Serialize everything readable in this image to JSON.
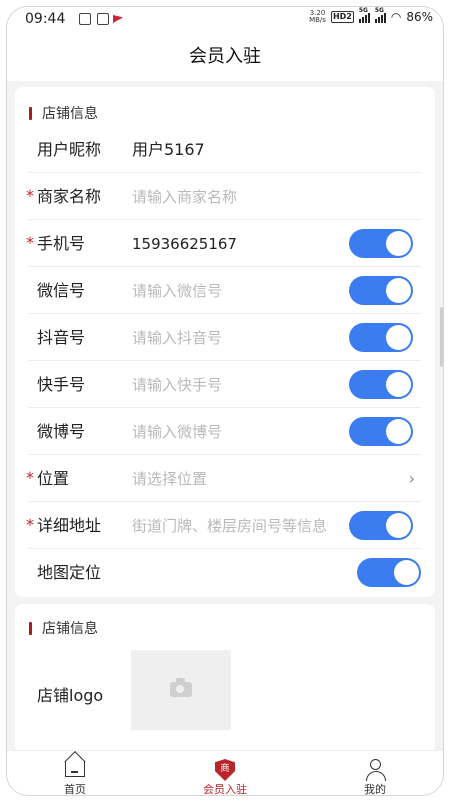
{
  "status_bar": {
    "time": "09:44",
    "net_speed_top": "3.20",
    "net_speed_unit": "MB/s",
    "hd": "HD2",
    "sig1": "5G",
    "sig2": "5G",
    "battery": "86%"
  },
  "header": {
    "title": "会员入驻"
  },
  "store_info": {
    "title": "店铺信息",
    "fields": [
      {
        "label": "用户昵称",
        "value": "用户5167",
        "required": false
      },
      {
        "label": "商家名称",
        "placeholder": "请输入商家名称",
        "required": true
      },
      {
        "label": "手机号",
        "value": "15936625167",
        "required": true,
        "toggle": true
      },
      {
        "label": "微信号",
        "placeholder": "请输入微信号",
        "required": false,
        "toggle": true
      },
      {
        "label": "抖音号",
        "placeholder": "请输入抖音号",
        "required": false,
        "toggle": true
      },
      {
        "label": "快手号",
        "placeholder": "请输入快手号",
        "required": false,
        "toggle": true
      },
      {
        "label": "微博号",
        "placeholder": "请输入微博号",
        "required": false,
        "toggle": true
      },
      {
        "label": "位置",
        "placeholder": "请选择位置",
        "required": true,
        "chevron": "›"
      },
      {
        "label": "详细地址",
        "placeholder": "街道门牌、楼层房间号等信息",
        "required": true,
        "toggle": true
      },
      {
        "label": "地图定位",
        "required": false,
        "toggle": true
      }
    ],
    "required_mark": "*"
  },
  "store_info_2": {
    "title": "店铺信息",
    "logo_label": "店铺logo",
    "upload_icon": "camera-icon"
  },
  "tabbar": {
    "tabs": [
      {
        "label": "首页",
        "icon": "home-icon",
        "active": false
      },
      {
        "label": "会员入驻",
        "icon": "shield-icon",
        "icon_text": "商",
        "active": true
      },
      {
        "label": "我的",
        "icon": "user-icon",
        "active": false
      }
    ]
  },
  "colors": {
    "accent": "#b8262c",
    "toggle_on": "#3b7cf0",
    "required": "#c0262d"
  }
}
